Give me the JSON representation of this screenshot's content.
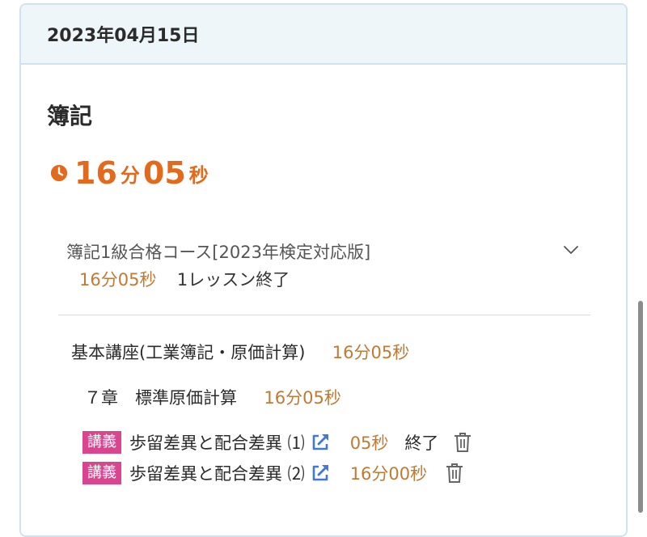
{
  "header": {
    "date": "2023年04月15日"
  },
  "subject": "簿記",
  "total_time": {
    "min": "16",
    "min_unit": "分",
    "sec": "05",
    "sec_unit": "秒"
  },
  "course": {
    "title": "簿記1級合格コース[2023年検定対応版]",
    "time": "16分05秒",
    "status": "1レッスン終了"
  },
  "lesson": {
    "title": "基本講座(工業簿記・原価計算)",
    "time": "16分05秒"
  },
  "chapter": {
    "title": "７章　標準原価計算",
    "time": "16分05秒"
  },
  "items": [
    {
      "tag": "講義",
      "title": "歩留差異と配合差異 ⑴",
      "time": "05秒",
      "status": "終了"
    },
    {
      "tag": "講義",
      "title": "歩留差異と配合差異 ⑵",
      "time": "16分00秒",
      "status": ""
    }
  ],
  "icons": {
    "clock": "clock-icon",
    "chevron": "chevron-down-icon",
    "external": "external-link-icon",
    "trash": "trash-icon"
  },
  "colors": {
    "accent": "#e36a1c",
    "time_text": "#c07a34",
    "tag_bg": "#d9468f",
    "link_icon": "#3f7ad8",
    "header_bg": "#eef6fa"
  }
}
